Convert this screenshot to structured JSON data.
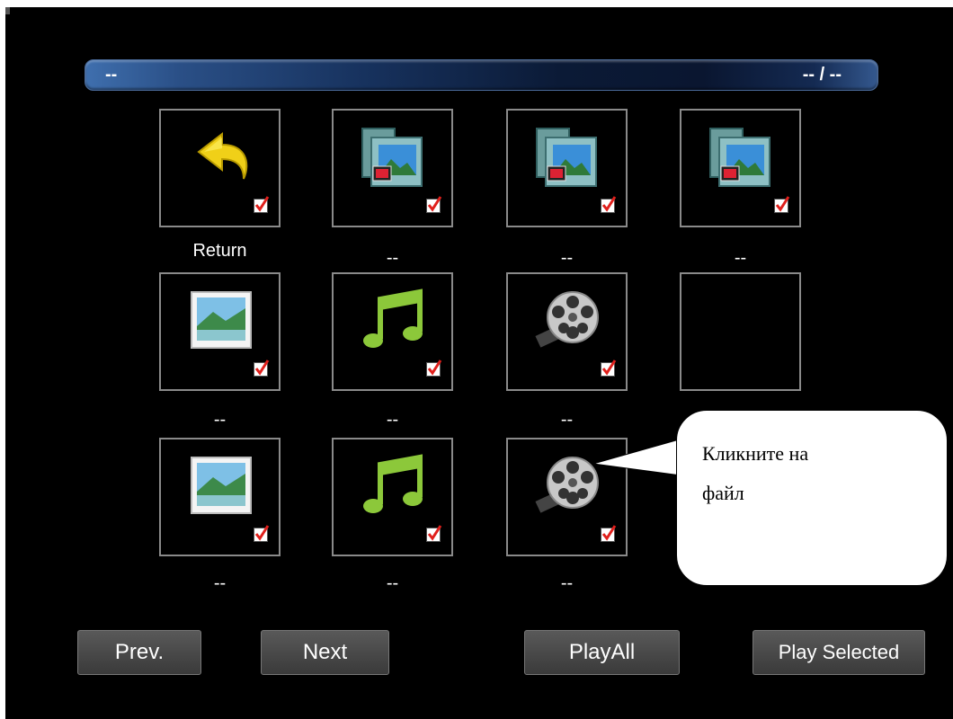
{
  "header": {
    "title": "--",
    "page_counter": "-- / --"
  },
  "grid": [
    {
      "label": "Return",
      "icon": "return-arrow-icon",
      "checked": true
    },
    {
      "label": "--",
      "icon": "photo-folder-icon",
      "checked": true
    },
    {
      "label": "--",
      "icon": "photo-folder-icon",
      "checked": true
    },
    {
      "label": "--",
      "icon": "photo-folder-icon",
      "checked": true
    },
    {
      "label": "--",
      "icon": "image-file-icon",
      "checked": true
    },
    {
      "label": "--",
      "icon": "music-note-icon",
      "checked": true
    },
    {
      "label": "--",
      "icon": "film-reel-icon",
      "checked": true
    },
    {
      "label": "",
      "icon": "empty-slot",
      "checked": false
    },
    {
      "label": "--",
      "icon": "image-file-icon",
      "checked": true
    },
    {
      "label": "--",
      "icon": "music-note-icon",
      "checked": true
    },
    {
      "label": "--",
      "icon": "film-reel-icon",
      "checked": true
    }
  ],
  "buttons": {
    "prev": "Prev.",
    "next": "Next",
    "play_all": "PlayAll",
    "play_selected": "Play Selected"
  },
  "callout": {
    "line1": "Кликните на",
    "line2": "файл"
  },
  "colors": {
    "accent": "#2a4f86",
    "checkmark": "#e0201c",
    "music": "#8cc83a",
    "arrow": "#f0d018"
  }
}
